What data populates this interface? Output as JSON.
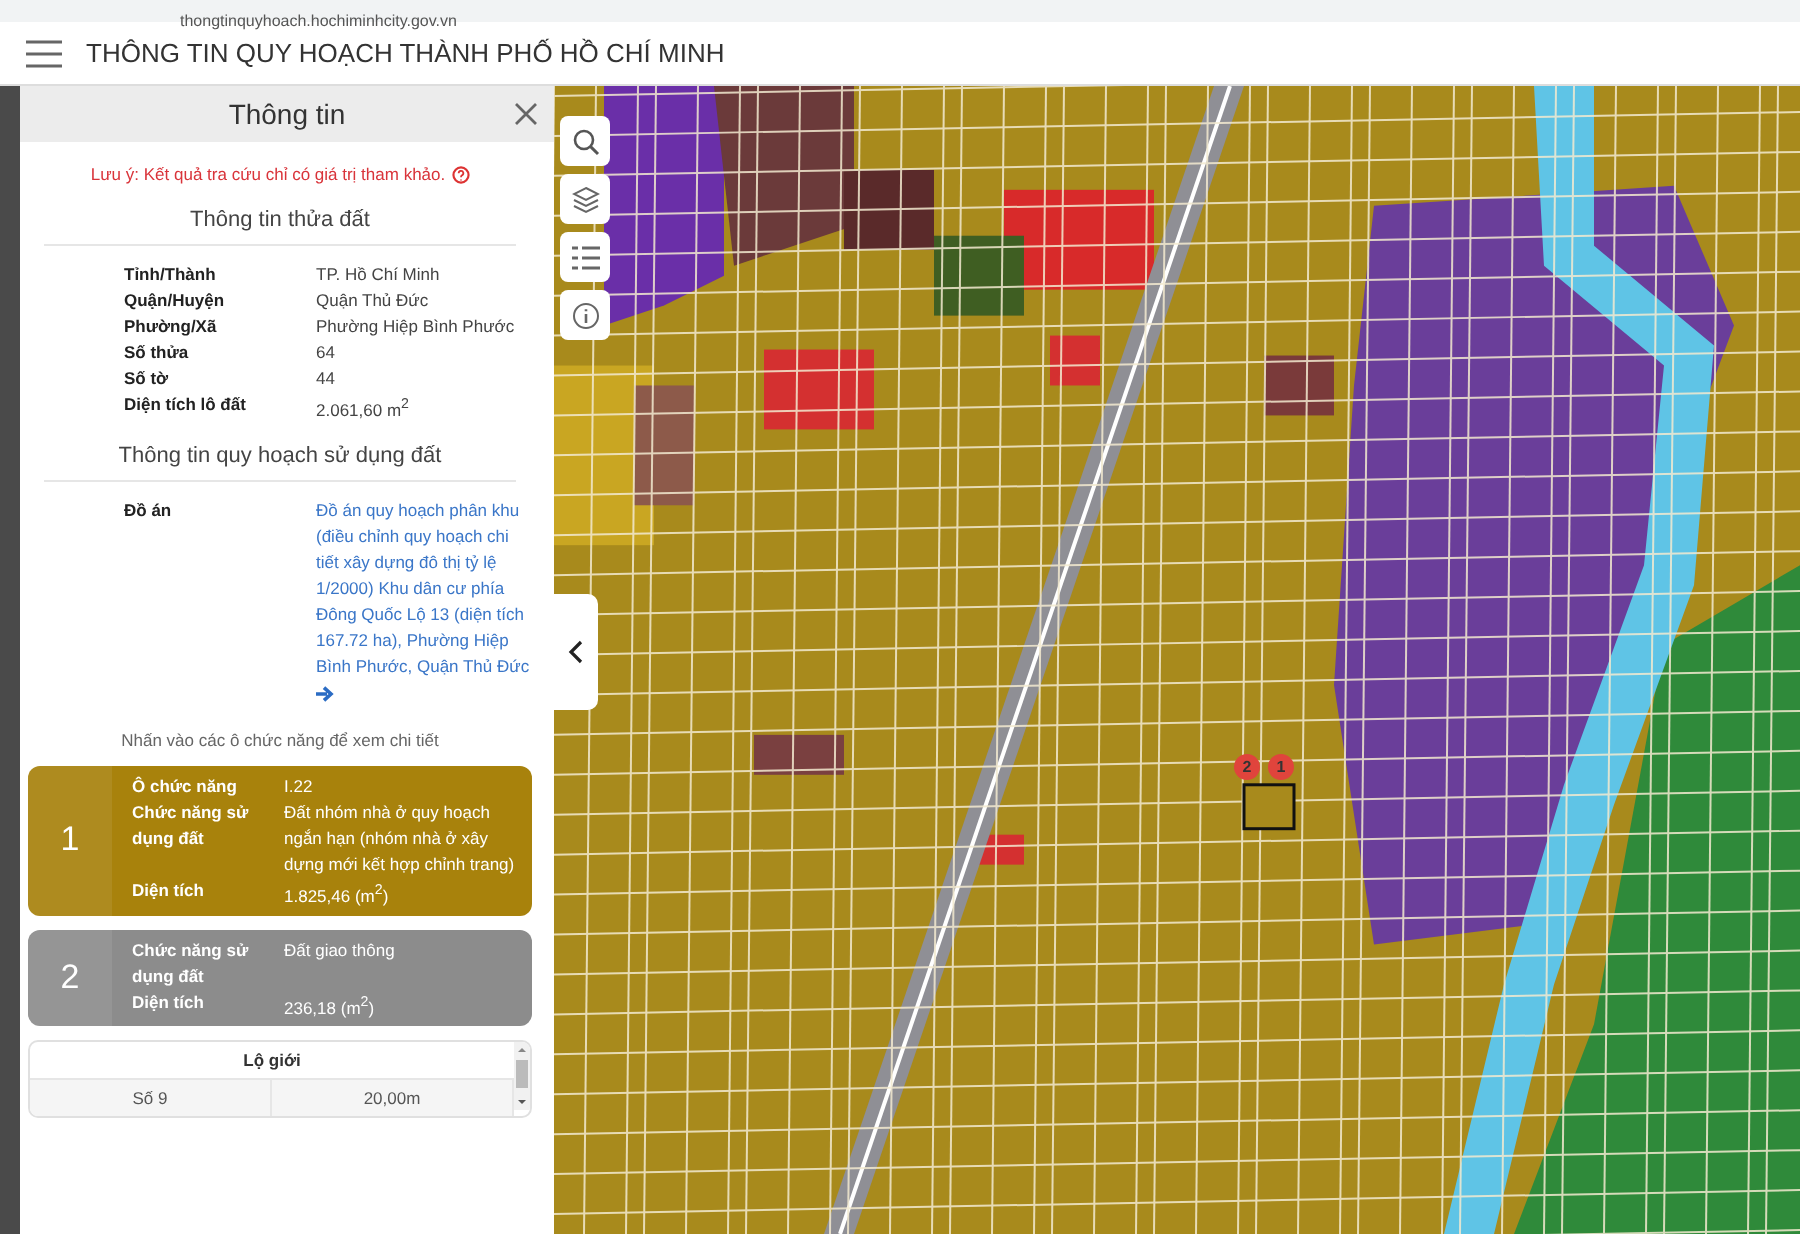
{
  "browser": {
    "url": "thongtinquyhoach.hochiminhcity.gov.vn"
  },
  "header": {
    "title": "THÔNG TIN QUY HOẠCH THÀNH PHỐ HỒ CHÍ MINH"
  },
  "panel": {
    "title": "Thông tin",
    "notice": "Lưu ý: Kết quả tra cứu chỉ có giá trị tham khảo.",
    "parcel": {
      "heading": "Thông tin thửa đất",
      "rows": [
        {
          "label": "Tỉnh/Thành",
          "value": "TP. Hồ Chí Minh"
        },
        {
          "label": "Quận/Huyện",
          "value": "Quận Thủ Đức"
        },
        {
          "label": "Phường/Xã",
          "value": "Phường Hiệp Bình Phước"
        },
        {
          "label": "Số thửa",
          "value": "64"
        },
        {
          "label": "Số tờ",
          "value": "44"
        },
        {
          "label": "Diện tích lô đất",
          "value": "2.061,60 m$^{2}$"
        }
      ]
    },
    "planning": {
      "heading": "Thông tin quy hoạch sử dụng đất",
      "label": "Đồ án",
      "link": "Đồ án quy hoạch phân khu (điều chỉnh quy hoạch chi tiết xây dựng đô thị tỷ lệ 1/2000) Khu dân cư phía Đông Quốc Lộ 13 (diện tích 167.72 ha), Phường Hiệp Bình Phước, Quận Thủ Đức"
    },
    "hint": "Nhấn vào các ô chức năng để xem chi tiết",
    "zones": [
      {
        "number": "1",
        "color": "#a8820c",
        "rows": [
          {
            "label": "Ô chức năng",
            "value": "I.22"
          },
          {
            "label": "Chức năng sử dụng đất",
            "value": "Đất nhóm nhà ở quy hoạch ngắn hạn (nhóm nhà ở xây dựng mới kết hợp chỉnh trang)"
          },
          {
            "label": "Diện tích",
            "value": "1.825,46 (m$^{2}$)"
          }
        ]
      },
      {
        "number": "2",
        "color": "#8c8c8c",
        "rows": [
          {
            "label": "Chức năng sử dụng đất",
            "value": "Đất giao thông"
          },
          {
            "label": "Diện tích",
            "value": "236,18 (m$^{2}$)"
          }
        ]
      }
    ],
    "road_boundary": {
      "title": "Lộ giới",
      "rows": [
        {
          "name": "Số 9",
          "width": "20,00m"
        }
      ]
    }
  },
  "map": {
    "pins": [
      "2",
      "1"
    ]
  }
}
